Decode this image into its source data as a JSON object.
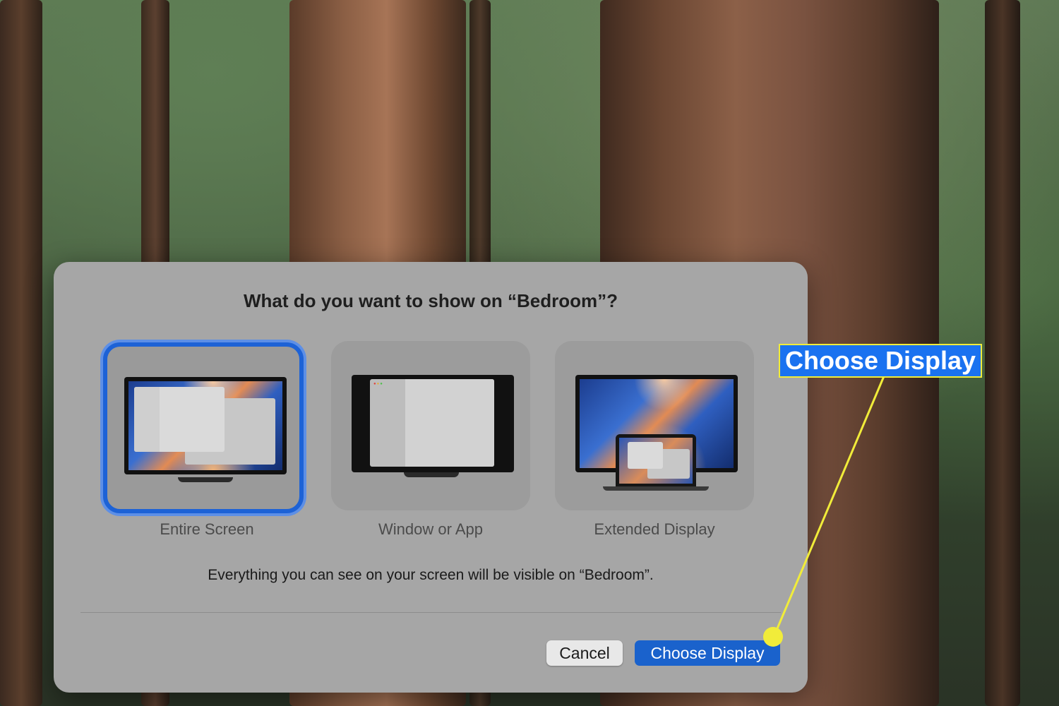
{
  "dialog": {
    "title": "What do you want to show on “Bedroom”?",
    "options": [
      {
        "label": "Entire Screen",
        "selected": true
      },
      {
        "label": "Window or App",
        "selected": false
      },
      {
        "label": "Extended Display",
        "selected": false
      }
    ],
    "description": "Everything you can see on your screen will be visible on “Bedroom”.",
    "buttons": {
      "cancel": "Cancel",
      "choose": "Choose Display"
    }
  },
  "annotation": {
    "callout_text": "Choose Display",
    "color": "#f1ec3a",
    "fill": "#1a72f0"
  },
  "colors": {
    "accent": "#1a62cc",
    "selection_border": "#1d62d6"
  }
}
